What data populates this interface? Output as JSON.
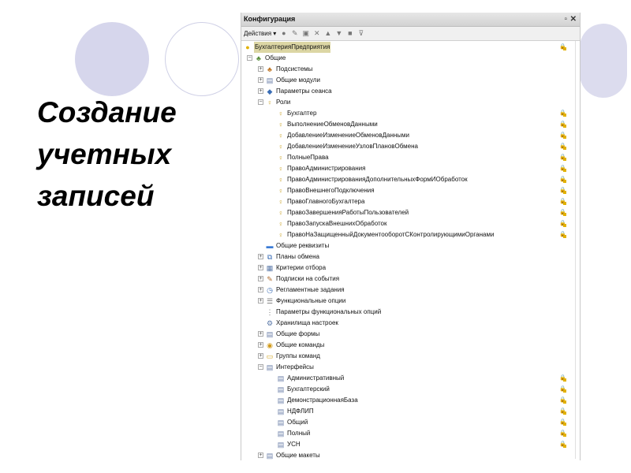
{
  "slide": {
    "title": "Создание\nучетных\nзаписей"
  },
  "window": {
    "title": "Конфигурация",
    "pin_glyph": "▫",
    "close_glyph": "✕"
  },
  "toolbar": {
    "actions_label": "Действия ▾"
  },
  "tree": [
    {
      "label": "БухгалтерияПредприятия",
      "level": 0,
      "expander": "",
      "icon": "config-icon",
      "glyph": "●",
      "color": "#e2b100",
      "lock": true,
      "selected": true
    },
    {
      "label": "Общие",
      "level": 1,
      "expander": "−",
      "icon": "common-icon",
      "glyph": "♣",
      "color": "#5b8f3e",
      "lock": false
    },
    {
      "label": "Подсистемы",
      "level": 2,
      "expander": "+",
      "icon": "subsystems-icon",
      "glyph": "♣",
      "color": "#c07a2d",
      "lock": false
    },
    {
      "label": "Общие модули",
      "level": 2,
      "expander": "+",
      "icon": "modules-icon",
      "glyph": "▤",
      "color": "#6b7fa8",
      "lock": false
    },
    {
      "label": "Параметры сеанса",
      "level": 2,
      "expander": "+",
      "icon": "session-params-icon",
      "glyph": "◆",
      "color": "#3a6db5",
      "lock": false
    },
    {
      "label": "Роли",
      "level": 2,
      "expander": "−",
      "icon": "roles-icon",
      "glyph": "♀",
      "color": "#c9a227",
      "lock": false
    },
    {
      "label": "Бухгалтер",
      "level": 3,
      "expander": "",
      "icon": "role-icon",
      "glyph": "♀",
      "color": "#c9a227",
      "lock": true
    },
    {
      "label": "ВыполнениеОбменовДанными",
      "level": 3,
      "expander": "",
      "icon": "role-icon",
      "glyph": "♀",
      "color": "#c9a227",
      "lock": true
    },
    {
      "label": "ДобавлениеИзменениеОбменовДанными",
      "level": 3,
      "expander": "",
      "icon": "role-icon",
      "glyph": "♀",
      "color": "#c9a227",
      "lock": true
    },
    {
      "label": "ДобавлениеИзменениеУзловПлановОбмена",
      "level": 3,
      "expander": "",
      "icon": "role-icon",
      "glyph": "♀",
      "color": "#c9a227",
      "lock": true
    },
    {
      "label": "ПолныеПрава",
      "level": 3,
      "expander": "",
      "icon": "role-icon",
      "glyph": "♀",
      "color": "#c9a227",
      "lock": true
    },
    {
      "label": "ПравоАдминистрирования",
      "level": 3,
      "expander": "",
      "icon": "role-icon",
      "glyph": "♀",
      "color": "#c9a227",
      "lock": true
    },
    {
      "label": "ПравоАдминистрированияДополнительныхФормИОбработок",
      "level": 3,
      "expander": "",
      "icon": "role-icon",
      "glyph": "♀",
      "color": "#c9a227",
      "lock": true
    },
    {
      "label": "ПравоВнешнегоПодключения",
      "level": 3,
      "expander": "",
      "icon": "role-icon",
      "glyph": "♀",
      "color": "#c9a227",
      "lock": true
    },
    {
      "label": "ПравоГлавногоБухгалтера",
      "level": 3,
      "expander": "",
      "icon": "role-icon",
      "glyph": "♀",
      "color": "#c9a227",
      "lock": true
    },
    {
      "label": "ПравоЗавершенияРаботыПользователей",
      "level": 3,
      "expander": "",
      "icon": "role-icon",
      "glyph": "♀",
      "color": "#c9a227",
      "lock": true
    },
    {
      "label": "ПравоЗапускаВнешнихОбработок",
      "level": 3,
      "expander": "",
      "icon": "role-icon",
      "glyph": "♀",
      "color": "#c9a227",
      "lock": true
    },
    {
      "label": "ПравоНаЗащищенныйДокументооборотСКонтролирующимиОрганами",
      "level": 3,
      "expander": "",
      "icon": "role-icon",
      "glyph": "♀",
      "color": "#c9a227",
      "lock": true
    },
    {
      "label": "Общие реквизиты",
      "level": 2,
      "expander": "",
      "icon": "common-attributes-icon",
      "glyph": "▬",
      "color": "#3a7bd5",
      "lock": false
    },
    {
      "label": "Планы обмена",
      "level": 2,
      "expander": "+",
      "icon": "exchange-plans-icon",
      "glyph": "⧉",
      "color": "#3a6db5",
      "lock": false
    },
    {
      "label": "Критерии отбора",
      "level": 2,
      "expander": "+",
      "icon": "filter-criteria-icon",
      "glyph": "▦",
      "color": "#5a78a8",
      "lock": false
    },
    {
      "label": "Подписки на события",
      "level": 2,
      "expander": "+",
      "icon": "event-subscriptions-icon",
      "glyph": "✎",
      "color": "#b06b2d",
      "lock": false
    },
    {
      "label": "Регламентные задания",
      "level": 2,
      "expander": "+",
      "icon": "scheduled-jobs-icon",
      "glyph": "◷",
      "color": "#3a6db5",
      "lock": false
    },
    {
      "label": "Функциональные опции",
      "level": 2,
      "expander": "+",
      "icon": "functional-options-icon",
      "glyph": "☰",
      "color": "#777777",
      "lock": false
    },
    {
      "label": "Параметры функциональных опций",
      "level": 2,
      "expander": "",
      "icon": "fo-params-icon",
      "glyph": "⋮",
      "color": "#777777",
      "lock": false
    },
    {
      "label": "Хранилища настроек",
      "level": 2,
      "expander": "",
      "icon": "settings-storage-icon",
      "glyph": "⚙",
      "color": "#5a78a8",
      "lock": false
    },
    {
      "label": "Общие формы",
      "level": 2,
      "expander": "+",
      "icon": "common-forms-icon",
      "glyph": "▤",
      "color": "#6b7fa8",
      "lock": false
    },
    {
      "label": "Общие команды",
      "level": 2,
      "expander": "+",
      "icon": "common-commands-icon",
      "glyph": "◉",
      "color": "#d19a1a",
      "lock": false
    },
    {
      "label": "Группы команд",
      "level": 2,
      "expander": "+",
      "icon": "command-groups-icon",
      "glyph": "▭",
      "color": "#d1a21a",
      "lock": false
    },
    {
      "label": "Интерфейсы",
      "level": 2,
      "expander": "−",
      "icon": "interfaces-icon",
      "glyph": "▤",
      "color": "#6b7fa8",
      "lock": false
    },
    {
      "label": "Административный",
      "level": 3,
      "expander": "",
      "icon": "interface-icon",
      "glyph": "▤",
      "color": "#6b7fa8",
      "lock": true
    },
    {
      "label": "Бухгалтерский",
      "level": 3,
      "expander": "",
      "icon": "interface-icon",
      "glyph": "▤",
      "color": "#6b7fa8",
      "lock": true
    },
    {
      "label": "ДемонстрационнаяБаза",
      "level": 3,
      "expander": "",
      "icon": "interface-icon",
      "glyph": "▤",
      "color": "#6b7fa8",
      "lock": true
    },
    {
      "label": "НДФЛИП",
      "level": 3,
      "expander": "",
      "icon": "interface-icon",
      "glyph": "▤",
      "color": "#6b7fa8",
      "lock": true
    },
    {
      "label": "Общий",
      "level": 3,
      "expander": "",
      "icon": "interface-icon",
      "glyph": "▤",
      "color": "#6b7fa8",
      "lock": true
    },
    {
      "label": "Полный",
      "level": 3,
      "expander": "",
      "icon": "interface-icon",
      "glyph": "▤",
      "color": "#6b7fa8",
      "lock": true
    },
    {
      "label": "УСН",
      "level": 3,
      "expander": "",
      "icon": "interface-icon",
      "glyph": "▤",
      "color": "#6b7fa8",
      "lock": true
    },
    {
      "label": "Общие макеты",
      "level": 2,
      "expander": "+",
      "icon": "common-templates-icon",
      "glyph": "▤",
      "color": "#6b7fa8",
      "lock": false
    }
  ]
}
